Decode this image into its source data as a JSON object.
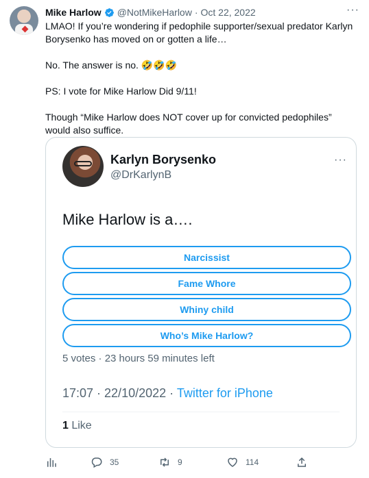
{
  "tweet": {
    "author_name": "Mike Harlow",
    "handle": "@NotMikeHarlow",
    "separator": "·",
    "date": "Oct 22, 2022",
    "more": "···",
    "paragraphs": [
      "LMAO! If you’re wondering if pedophile supporter/sexual predator Karlyn Borysenko has moved on or gotten a life…",
      "No. The answer is no. 🤣🤣🤣",
      "PS: I vote for Mike Harlow Did 9/11!",
      "Though “Mike Harlow does NOT cover up for convicted pedophiles” would also suffice."
    ]
  },
  "quoted": {
    "author_name": "Karlyn Borysenko",
    "handle": "@DrKarlynB",
    "more": "···",
    "text": "Mike Harlow is a….",
    "poll_options": [
      "Narcissist",
      "Fame Whore",
      "Whiny child",
      "Who’s Mike Harlow?"
    ],
    "poll_meta": "5 votes · 23 hours 59 minutes left",
    "time": "17:07 · 22/10/2022 · ",
    "source": "Twitter for iPhone",
    "likes_count": "1",
    "likes_label": " Like"
  },
  "actions": {
    "replies": "35",
    "retweets": "9",
    "likes": "114"
  },
  "colors": {
    "accent": "#1d9bf0",
    "muted": "#536471",
    "border": "#cfd9de"
  },
  "icons": [
    "verified-badge-icon",
    "analytics-icon",
    "reply-icon",
    "retweet-icon",
    "like-icon",
    "share-icon",
    "more-icon"
  ]
}
